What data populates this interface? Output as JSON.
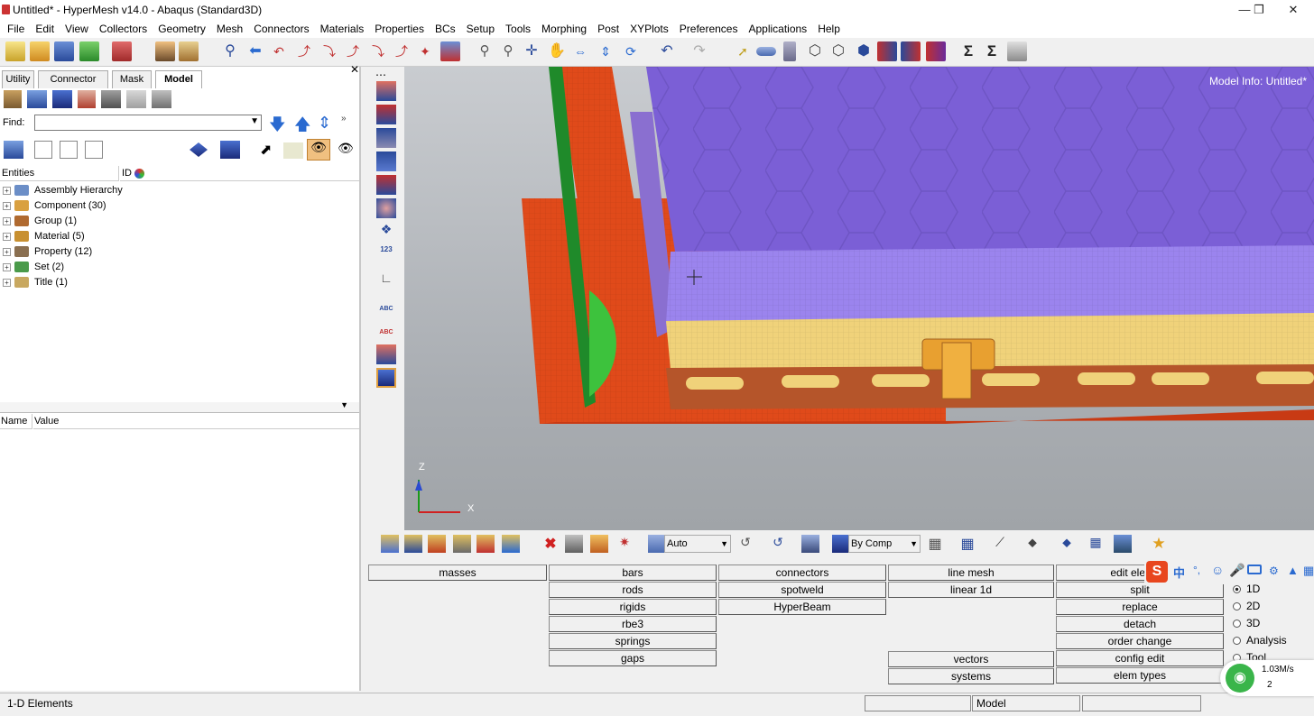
{
  "titlebar": {
    "title": "Untitled* - HyperMesh v14.0 - Abaqus (Standard3D)"
  },
  "menus": [
    "File",
    "Edit",
    "View",
    "Collectors",
    "Geometry",
    "Mesh",
    "Connectors",
    "Materials",
    "Properties",
    "BCs",
    "Setup",
    "Tools",
    "Morphing",
    "Post",
    "XYPlots",
    "Preferences",
    "Applications",
    "Help"
  ],
  "tabs": [
    "Utility",
    "Connector",
    "Mask",
    "Model"
  ],
  "find": {
    "label": "Find:",
    "value": ""
  },
  "entities": {
    "header_entities": "Entities",
    "header_id": "ID",
    "items": [
      {
        "label": "Assembly Hierarchy",
        "color": "#6b8ec7"
      },
      {
        "label": "Component (30)",
        "color": "#d9a040"
      },
      {
        "label": "Group (1)",
        "color": "#b06a30"
      },
      {
        "label": "Material (5)",
        "color": "#c89030"
      },
      {
        "label": "Property (12)",
        "color": "#8a6f50"
      },
      {
        "label": "Set (2)",
        "color": "#4a9a4a"
      },
      {
        "label": "Title (1)",
        "color": "#c8a860"
      }
    ]
  },
  "name_value": {
    "name": "Name",
    "value": "Value"
  },
  "viewport": {
    "model_info": "Model Info: Untitled*",
    "axis_z": "Z",
    "axis_x": "X"
  },
  "bottom_toolbar": {
    "auto": "Auto",
    "bycomp": "By Comp"
  },
  "panel": {
    "col1": [
      "masses"
    ],
    "col2": [
      "bars",
      "rods",
      "rigids",
      "rbe3",
      "springs",
      "gaps"
    ],
    "col3": [
      "connectors",
      "spotweld",
      "HyperBeam"
    ],
    "col4": [
      "line mesh",
      "linear 1d",
      "vectors",
      "systems"
    ],
    "col5": [
      "edit element",
      "split",
      "replace",
      "detach",
      "order change",
      "config edit",
      "elem types"
    ],
    "radios": [
      "1D",
      "2D",
      "3D",
      "Analysis",
      "Tool"
    ]
  },
  "statusbar": {
    "left": "1-D Elements",
    "model": "Model"
  },
  "network": {
    "speed": "1.03M/s",
    "count": "2"
  },
  "colors": {
    "purple": "#7b5fd6",
    "lightpurple": "#9b84ee",
    "orange": "#e04a1a",
    "green": "#3dc23d",
    "yellow": "#f0d27a",
    "brown": "#b5552a"
  }
}
